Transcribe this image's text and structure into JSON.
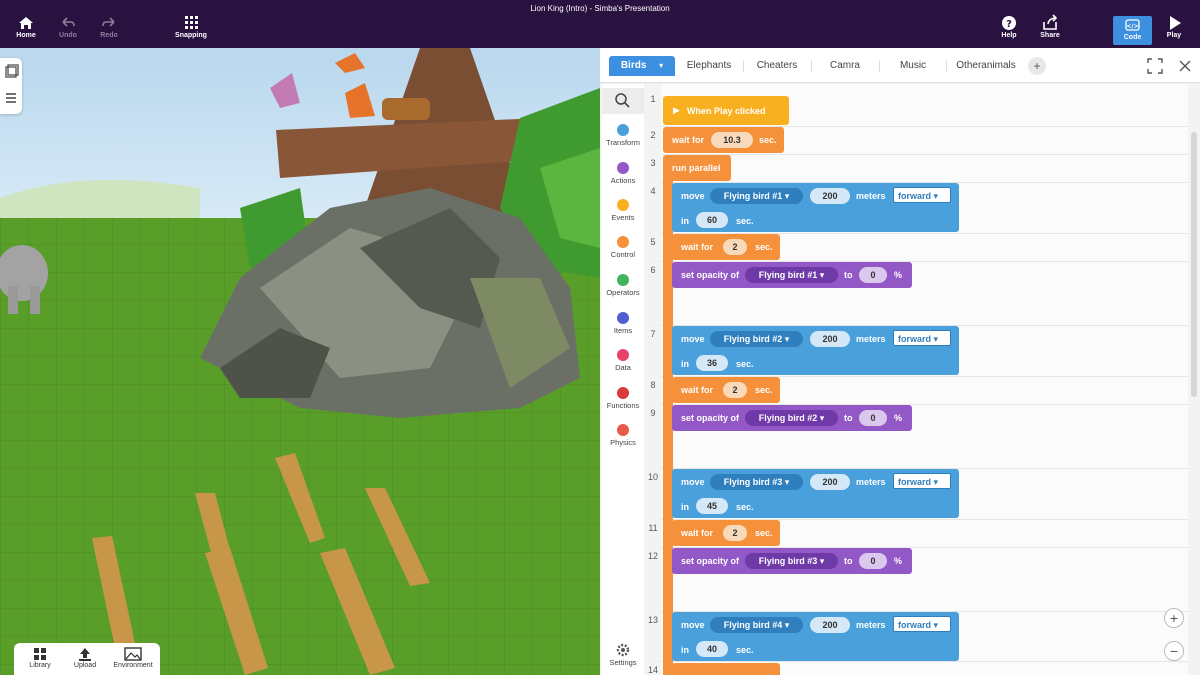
{
  "window": {
    "title": "Lion King (Intro) -  Simba's  Presentation"
  },
  "toolbar": {
    "home": "Home",
    "undo": "Undo",
    "redo": "Redo",
    "snapping": "Snapping",
    "help": "Help",
    "share": "Share",
    "code": "Code",
    "play": "Play"
  },
  "dock": {
    "library": "Library",
    "upload": "Upload",
    "environment": "Environment"
  },
  "tabs": [
    "Birds",
    "Elephants",
    "Cheaters",
    "Camra",
    "Music",
    "Otheranimals"
  ],
  "categories": [
    "Transform",
    "Actions",
    "Events",
    "Control",
    "Operators",
    "Items",
    "Data",
    "Functions",
    "Physics"
  ],
  "settings": "Settings",
  "lines": [
    "1",
    "2",
    "3",
    "4",
    "5",
    "6",
    "7",
    "8",
    "9",
    "10",
    "11",
    "12",
    "13",
    "14"
  ],
  "code": {
    "when_play": "When Play clicked",
    "wait_for": "wait for",
    "sec": "sec.",
    "run_parallel": "run parallel",
    "move": "move",
    "meters": "meters",
    "in": "in",
    "set_opacity": "set opacity of",
    "to": "to",
    "pct": "%",
    "forward": "forward",
    "wait1": "10.3",
    "birds": [
      "Flying bird #1",
      "Flying bird #2",
      "Flying bird #3",
      "Flying bird #4"
    ],
    "dist": [
      "200",
      "200",
      "200",
      "200"
    ],
    "dur": [
      "60",
      "36",
      "45",
      "40"
    ],
    "waits": [
      "2",
      "2",
      "2"
    ],
    "opacity": [
      "0",
      "0",
      "0"
    ]
  }
}
